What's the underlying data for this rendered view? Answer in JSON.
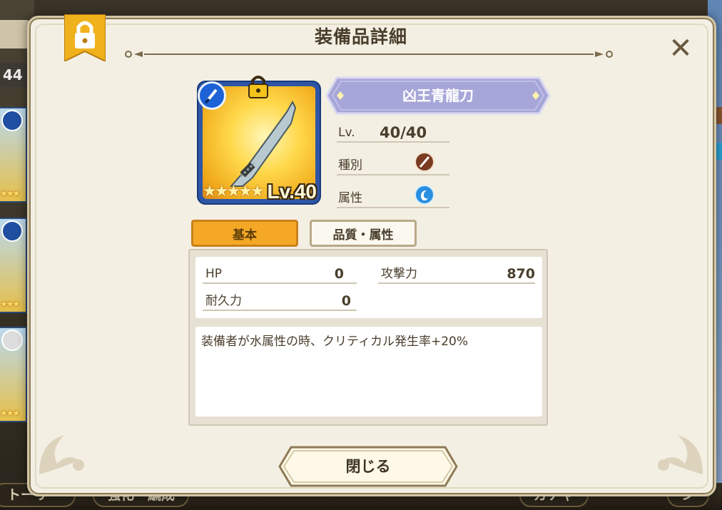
{
  "background": {
    "count_text": "44",
    "nav": [
      {
        "label": "トーリー"
      },
      {
        "label": "強化・編成"
      },
      {
        "label": "ガチャ"
      },
      {
        "label": "シ"
      }
    ]
  },
  "modal": {
    "title": "装備品詳細",
    "close_icon": "close-icon",
    "lock_icon": "lock-icon"
  },
  "item": {
    "name": "凶王青龍刀",
    "level_badge": "Lv.40",
    "stars": "★★★★★",
    "star_count": 5,
    "type_icon": "sword-icon",
    "level_label": "Lv.",
    "level_value": "40/40",
    "category_label": "種別",
    "category_icon": "sword-type-icon",
    "attribute_label": "属性",
    "attribute_icon": "water-attribute-icon"
  },
  "tabs": [
    {
      "label": "基本",
      "active": true
    },
    {
      "label": "品質・属性",
      "active": false
    }
  ],
  "stats": [
    {
      "label": "HP",
      "value": "0"
    },
    {
      "label": "攻撃力",
      "value": "870"
    },
    {
      "label": "耐久力",
      "value": "0"
    }
  ],
  "description": "装備者が水属性の時、クリティカル発生率+20%",
  "close_button_label": "閉じる",
  "colors": {
    "tab_active": "#f4a825",
    "banner": "#a7a6d8",
    "item_bg": "#ffd84a",
    "item_frame": "#2f56a6"
  }
}
